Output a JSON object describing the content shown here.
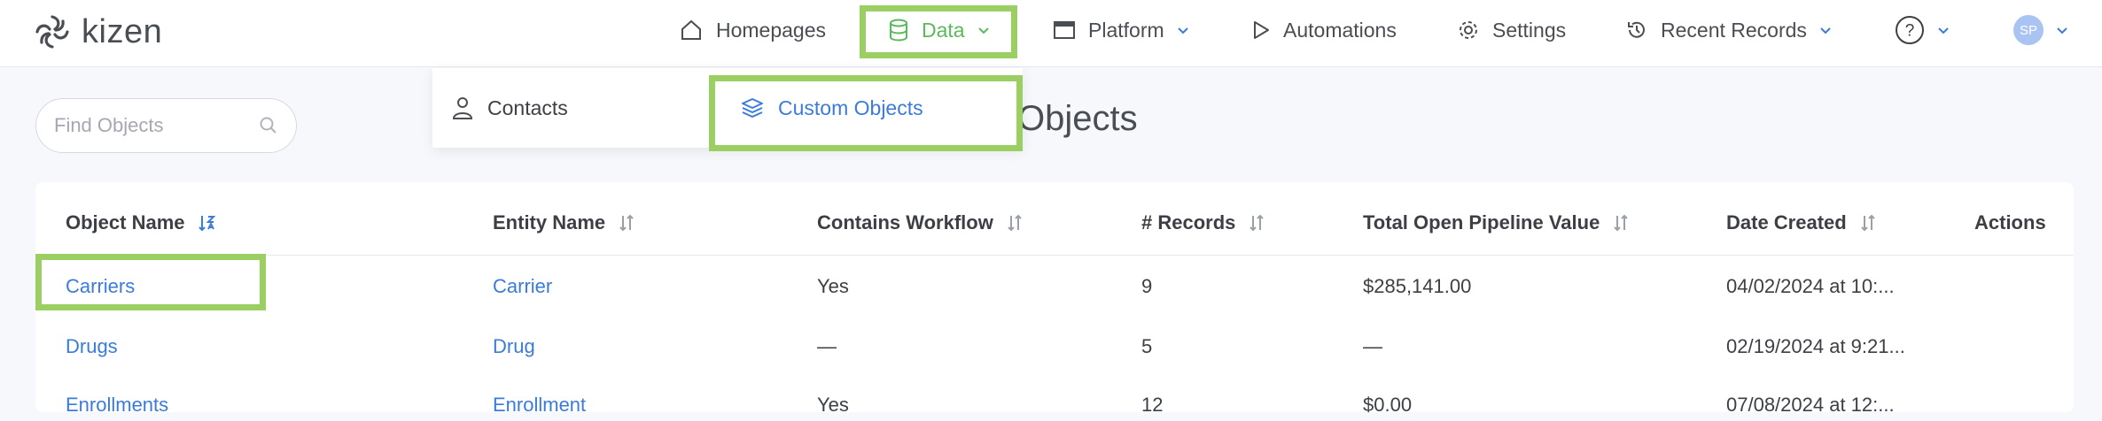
{
  "brand": {
    "name": "kizen"
  },
  "nav": {
    "homepages": "Homepages",
    "data": "Data",
    "platform": "Platform",
    "automations": "Automations",
    "settings": "Settings",
    "recent_records": "Recent Records",
    "avatar_initials": "SP"
  },
  "dropdown": {
    "contacts": "Contacts",
    "custom_objects": "Custom Objects"
  },
  "search": {
    "placeholder": "Find Objects"
  },
  "page": {
    "heading_visible": "Objects"
  },
  "table": {
    "columns": [
      "Object Name",
      "Entity Name",
      "Contains Workflow",
      "# Records",
      "Total Open Pipeline Value",
      "Date Created",
      "Actions"
    ],
    "rows": [
      {
        "object_name": "Carriers",
        "entity_name": "Carrier",
        "workflow": "Yes",
        "records": "9",
        "pipeline": "$285,141.00",
        "date": "04/02/2024 at 10:..."
      },
      {
        "object_name": "Drugs",
        "entity_name": "Drug",
        "workflow": "—",
        "records": "5",
        "pipeline": "—",
        "date": "02/19/2024 at 9:21..."
      },
      {
        "object_name": "Enrollments",
        "entity_name": "Enrollment",
        "workflow": "Yes",
        "records": "12",
        "pipeline": "$0.00",
        "date": "07/08/2024 at 12:..."
      }
    ]
  },
  "colors": {
    "accent_green": "#5cb85c",
    "highlight": "#9bcf63",
    "link_blue": "#3b7bd9"
  }
}
